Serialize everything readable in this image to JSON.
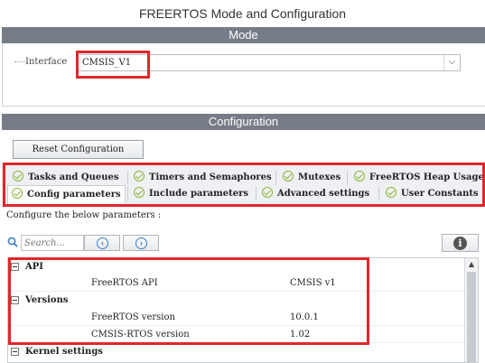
{
  "window": {
    "title": "FREERTOS Mode and Configuration"
  },
  "mode": {
    "header": "Mode",
    "interface_label": "Interface",
    "interface_value": "CMSIS_V1"
  },
  "configuration": {
    "header": "Configuration",
    "reset_label": "Reset Configuration",
    "tabs": [
      {
        "label": "Tasks and Queues"
      },
      {
        "label": "Timers and Semaphores"
      },
      {
        "label": "Mutexes"
      },
      {
        "label": "FreeRTOS Heap Usage"
      },
      {
        "label": "Config parameters",
        "active": true
      },
      {
        "label": "Include parameters"
      },
      {
        "label": "Advanced settings"
      },
      {
        "label": "User Constants"
      }
    ],
    "hint": "Configure the below parameters :",
    "search_placeholder": "Search...",
    "tree": [
      {
        "group": "API",
        "params": [
          {
            "name": "FreeRTOS API",
            "value": "CMSIS v1"
          }
        ]
      },
      {
        "group": "Versions",
        "params": [
          {
            "name": "FreeRTOS version",
            "value": "10.0.1"
          },
          {
            "name": "CMSIS-RTOS version",
            "value": "1.02"
          }
        ]
      },
      {
        "group": "Kernel settings",
        "params": []
      }
    ]
  },
  "colors": {
    "section_bar": "#767c87",
    "highlight": "#e2262b",
    "check": "#8ab833",
    "nav_accent": "#3a7fc9"
  }
}
